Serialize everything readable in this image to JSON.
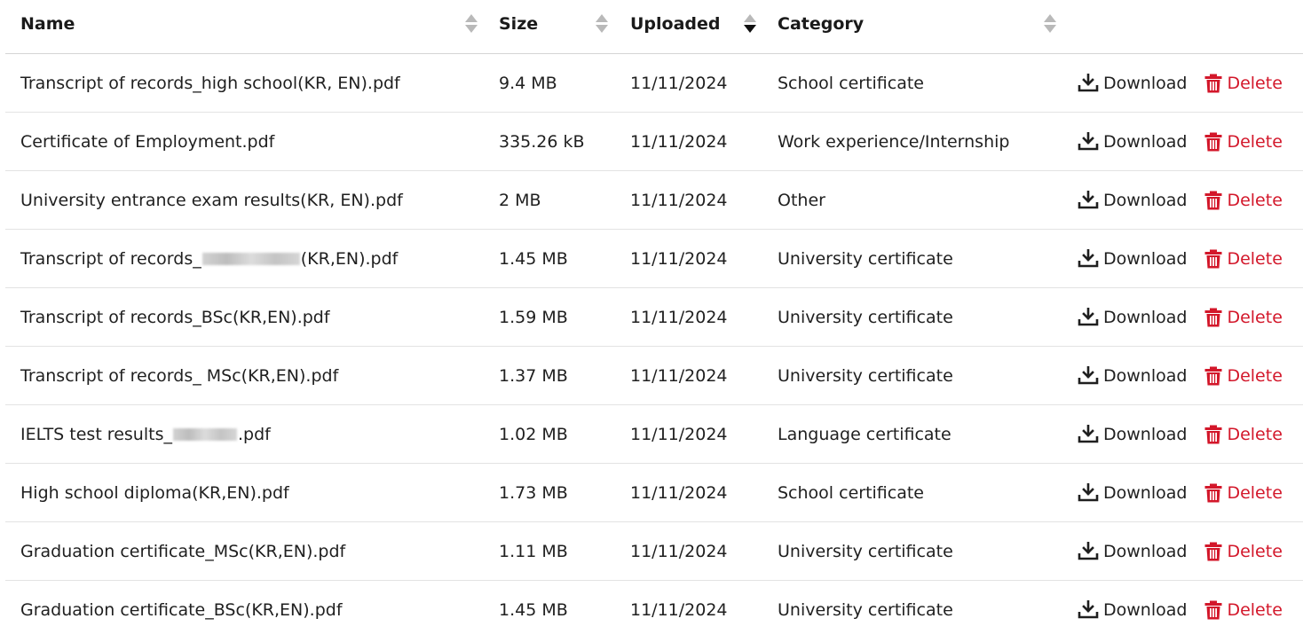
{
  "columns": {
    "name": "Name",
    "size": "Size",
    "uploaded": "Uploaded",
    "category": "Category"
  },
  "sort": {
    "column": "uploaded",
    "direction": "descending"
  },
  "actions": {
    "download_label": "Download",
    "delete_label": "Delete",
    "download_icon": "download-icon",
    "delete_icon": "trash-icon"
  },
  "colors": {
    "delete": "#d3172a",
    "text": "#1f1f1f",
    "row_divider": "#e3e3e3"
  },
  "files": [
    {
      "name": "Transcript of records_high school(KR, EN).pdf",
      "size": "9.4 MB",
      "uploaded": "11/11/2024",
      "category": "School certificate"
    },
    {
      "name": "Certificate of Employment.pdf",
      "size": "335.26 kB",
      "uploaded": "11/11/2024",
      "category": "Work experience/Internship"
    },
    {
      "name": "University entrance exam results(KR, EN).pdf",
      "size": "2 MB",
      "uploaded": "11/11/2024",
      "category": "Other"
    },
    {
      "name_prefix": "Transcript of records_",
      "name_suffix": "(KR,EN).pdf",
      "size": "1.45 MB",
      "uploaded": "11/11/2024",
      "category": "University certificate"
    },
    {
      "name": "Transcript of records_BSc(KR,EN).pdf",
      "size": "1.59 MB",
      "uploaded": "11/11/2024",
      "category": "University certificate"
    },
    {
      "name": "Transcript of records_ MSc(KR,EN).pdf",
      "size": "1.37 MB",
      "uploaded": "11/11/2024",
      "category": "University certificate"
    },
    {
      "name_prefix": "IELTS test results_",
      "name_suffix": ".pdf",
      "size": "1.02 MB",
      "uploaded": "11/11/2024",
      "category": "Language certificate"
    },
    {
      "name": "High school diploma(KR,EN).pdf",
      "size": "1.73 MB",
      "uploaded": "11/11/2024",
      "category": "School certificate"
    },
    {
      "name": "Graduation certificate_MSc(KR,EN).pdf",
      "size": "1.11 MB",
      "uploaded": "11/11/2024",
      "category": "University certificate"
    },
    {
      "name": "Graduation certificate_BSc(KR,EN).pdf",
      "size": "1.45 MB",
      "uploaded": "11/11/2024",
      "category": "University certificate"
    }
  ]
}
